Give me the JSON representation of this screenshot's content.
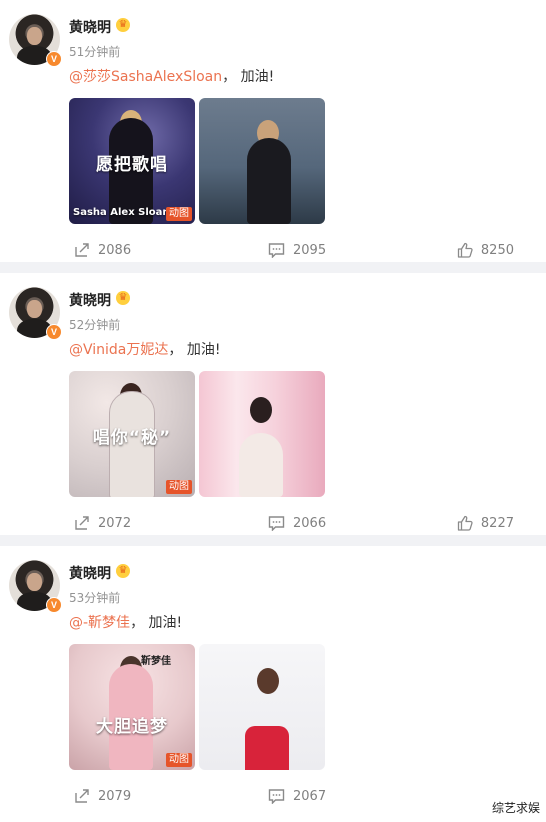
{
  "posts": [
    {
      "author": "黄晓明",
      "time": "51分钟前",
      "mention": "@莎莎SashaAlexSloan",
      "text": "， 加油!",
      "images": [
        {
          "overlay": "愿把歌唱",
          "sub": "Sasha Alex Sloan",
          "gif_badge": "动图"
        },
        {}
      ],
      "share_count": "2086",
      "comment_count": "2095",
      "like_count": "8250"
    },
    {
      "author": "黄晓明",
      "time": "52分钟前",
      "mention": "@Vinida万妮达",
      "text": "， 加油!",
      "images": [
        {
          "overlay": "唱你“秘”",
          "sub": "",
          "gif_badge": "动图"
        },
        {}
      ],
      "share_count": "2072",
      "comment_count": "2066",
      "like_count": "8227"
    },
    {
      "author": "黄晓明",
      "time": "53分钟前",
      "mention": "@-靳梦佳",
      "text": "， 加油!",
      "images": [
        {
          "overlay": "大胆追梦",
          "sub": "靳梦佳",
          "gif_badge": "动图"
        },
        {}
      ],
      "share_count": "2079",
      "comment_count": "2067",
      "like_count": ""
    }
  ],
  "watermark": "综艺求娱",
  "icons": {
    "verified": "verified-v-icon",
    "crown": "crown-icon",
    "share": "share-icon",
    "comment": "comment-icon",
    "like": "thumbs-up-icon"
  },
  "colors": {
    "mention": "#eb7350",
    "verified_badge": "#f7892d",
    "gif_badge": "#e6542a",
    "separator": "#f1f2f5"
  }
}
